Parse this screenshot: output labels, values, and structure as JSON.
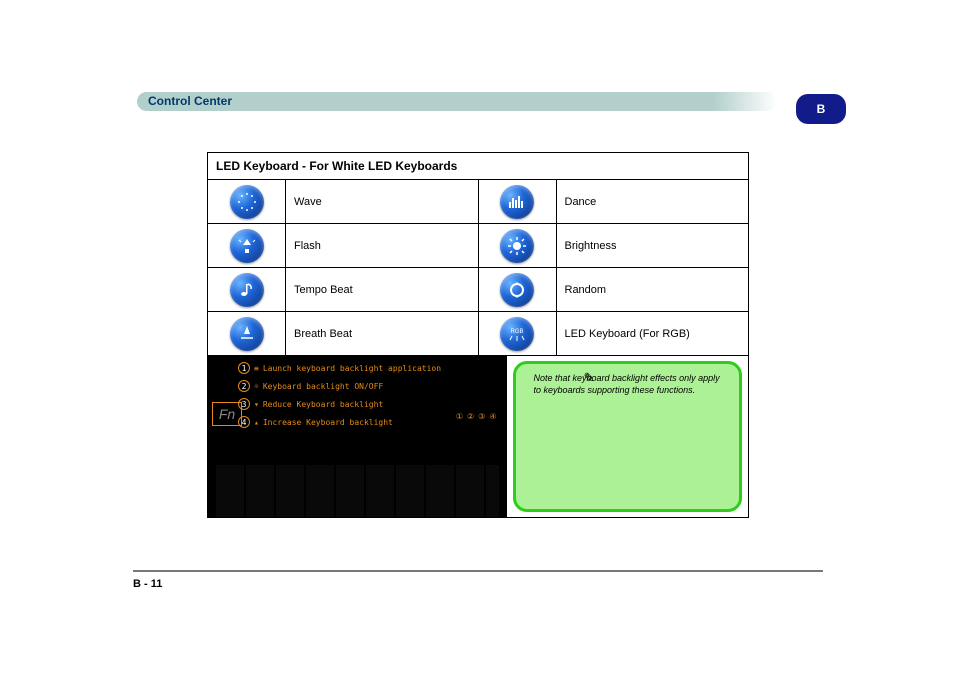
{
  "header": {
    "title": "Control Center",
    "tab": "B"
  },
  "table": {
    "title": "LED Keyboard - For White LED Keyboards",
    "rows": [
      {
        "left": {
          "icon": "wave",
          "label": "Wave"
        },
        "right": {
          "icon": "dance",
          "label": "Dance"
        }
      },
      {
        "left": {
          "icon": "flash",
          "label": "Flash"
        },
        "right": {
          "icon": "brightness",
          "label": "Brightness"
        }
      },
      {
        "left": {
          "icon": "tempo",
          "label": "Tempo Beat"
        },
        "right": {
          "icon": "random",
          "label": "Random"
        }
      },
      {
        "left": {
          "icon": "beat",
          "label": "Breath Beat"
        },
        "right": {
          "icon": "rgb",
          "label": "LED Keyboard (For RGB)"
        }
      }
    ]
  },
  "keyboard": {
    "fn": "Fn",
    "lines": [
      {
        "num": "1",
        "text": "Launch keyboard backlight application"
      },
      {
        "num": "2",
        "text": "Keyboard backlight ON/OFF"
      },
      {
        "num": "3",
        "text": "Reduce Keyboard backlight"
      },
      {
        "num": "4",
        "text": "Increase Keyboard backlight"
      }
    ],
    "markers": [
      "①",
      "②",
      "③",
      "④"
    ]
  },
  "note": {
    "text": "Note that keyboard backlight effects only apply to keyboards supporting these functions."
  },
  "footer": {
    "page": "B - 11"
  }
}
